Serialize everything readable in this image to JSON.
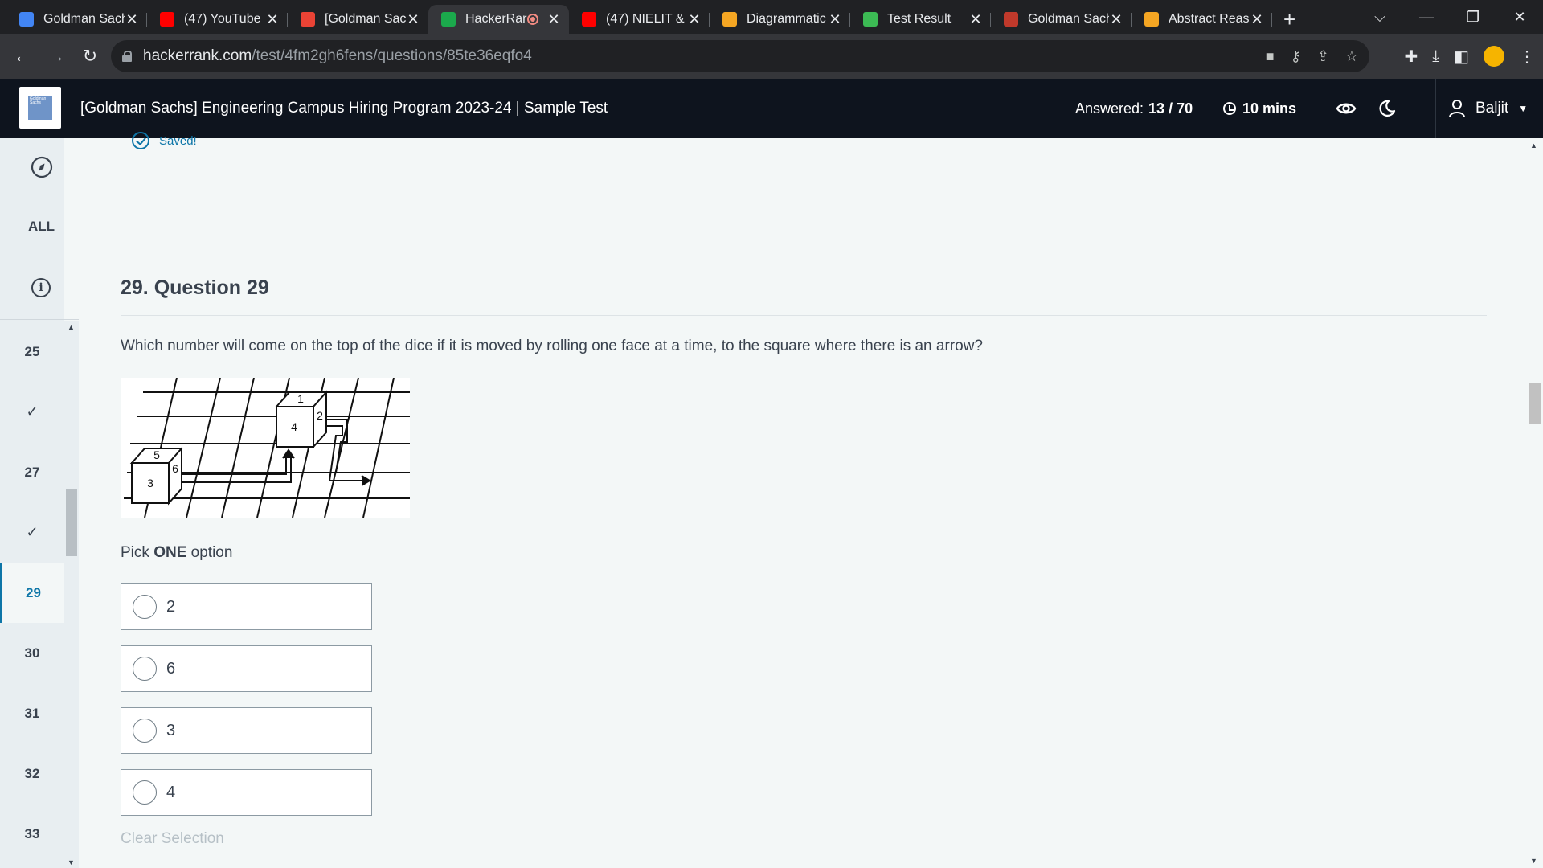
{
  "browser": {
    "tabs": [
      {
        "title": "Goldman Sach",
        "icon": "google-forms-icon",
        "color": "#4285f4",
        "active": false
      },
      {
        "title": "(47) YouTube",
        "icon": "youtube-icon",
        "color": "#ff0000",
        "active": false
      },
      {
        "title": "[Goldman Sac",
        "icon": "gmail-icon",
        "color": "#ea4335",
        "active": false
      },
      {
        "title": "HackerRar",
        "icon": "hackerrank-icon",
        "color": "#1ba94c",
        "active": true,
        "recording": true
      },
      {
        "title": "(47) NIELIT &",
        "icon": "youtube-icon",
        "color": "#ff0000",
        "active": false
      },
      {
        "title": "Diagrammatic",
        "icon": "warning-icon",
        "color": "#f5a623",
        "active": false
      },
      {
        "title": "Test Result",
        "icon": "umbrella-icon",
        "color": "#3cba54",
        "active": false
      },
      {
        "title": "Goldman Sach",
        "icon": "bull-icon",
        "color": "#c0392b",
        "active": false
      },
      {
        "title": "Abstract Reasc",
        "icon": "warning-icon",
        "color": "#f5a623",
        "active": false
      }
    ],
    "url_host": "hackerrank.com",
    "url_path": "/test/4fm2gh6fens/questions/85te36eqfo4"
  },
  "header": {
    "title": "[Goldman Sachs] Engineering Campus Hiring Program 2023-24 | Sample Test",
    "answered_label": "Answered:",
    "answered_value": "13 / 70",
    "timer": "10 mins",
    "user": "Baljit",
    "logo_text": "Goldman Sachs"
  },
  "sidebar": {
    "all_label": "ALL",
    "info_symbol": "i",
    "questions": [
      {
        "label": "25",
        "type": "number",
        "current": false
      },
      {
        "label": "✓",
        "type": "check",
        "current": false
      },
      {
        "label": "27",
        "type": "number",
        "current": false
      },
      {
        "label": "✓",
        "type": "check",
        "current": false
      },
      {
        "label": "29",
        "type": "number",
        "current": true
      },
      {
        "label": "30",
        "type": "number",
        "current": false
      },
      {
        "label": "31",
        "type": "number",
        "current": false
      },
      {
        "label": "32",
        "type": "number",
        "current": false
      },
      {
        "label": "33",
        "type": "number",
        "current": false
      }
    ]
  },
  "question": {
    "saved_label": "Saved!",
    "title": "29. Question 29",
    "text": "Which number will come on the top of the dice if it is moved by rolling one face at a time, to the square where there is an arrow?",
    "figure_labels": {
      "start_top": "5",
      "start_front": "3",
      "start_side": "6",
      "end_top": "1",
      "end_front": "4",
      "end_side": "2"
    },
    "pick_prefix": "Pick ",
    "pick_bold": "ONE",
    "pick_suffix": " option",
    "options": [
      "2",
      "6",
      "3",
      "4"
    ],
    "clear_label": "Clear Selection"
  }
}
